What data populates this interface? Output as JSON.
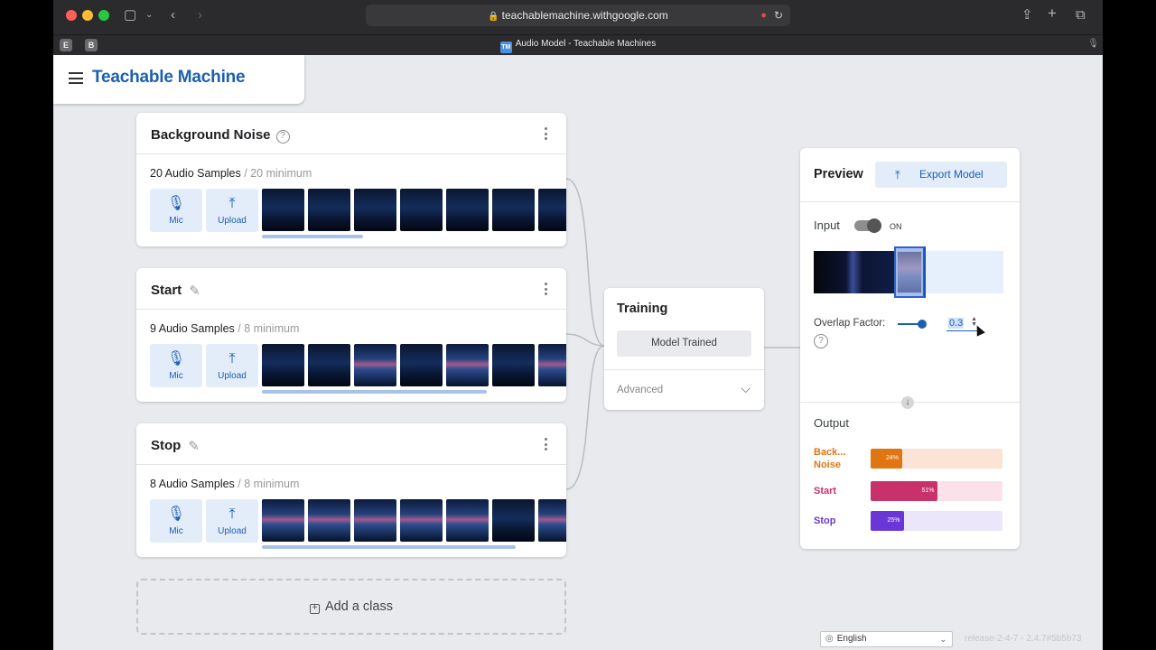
{
  "browser": {
    "url": "teachablemachine.withgoogle.com",
    "tab_title": "Audio Model - Teachable Machines",
    "pinned_tabs": [
      "E",
      "B"
    ],
    "favicon_text": "TM"
  },
  "header": {
    "brand": "Teachable Machine"
  },
  "classes": [
    {
      "title": "Background Noise",
      "count": "20 Audio Samples",
      "minimum": "/ 20 minimum",
      "mic_label": "Mic",
      "upload_label": "Upload"
    },
    {
      "title": "Start",
      "count": "9 Audio Samples",
      "minimum": "/ 8 minimum",
      "mic_label": "Mic",
      "upload_label": "Upload"
    },
    {
      "title": "Stop",
      "count": "8 Audio Samples",
      "minimum": "/ 8 minimum",
      "mic_label": "Mic",
      "upload_label": "Upload"
    }
  ],
  "add_class_label": "Add a class",
  "training": {
    "title": "Training",
    "button": "Model Trained",
    "advanced": "Advanced"
  },
  "preview": {
    "title": "Preview",
    "export_label": "Export Model",
    "input_label": "Input",
    "toggle_state": "ON",
    "overlap_label": "Overlap Factor:",
    "overlap_value": "0.3",
    "output_label": "Output",
    "outputs": [
      {
        "name_line1": "Back...",
        "name_line2": "Noise",
        "percent_label": "24%",
        "percent": 24,
        "color": "#e07512",
        "bg": "#fbe3d6"
      },
      {
        "name_line1": "Start",
        "name_line2": "",
        "percent_label": "51%",
        "percent": 51,
        "color": "#c9316b",
        "bg": "#fbe1ea"
      },
      {
        "name_line1": "Stop",
        "name_line2": "",
        "percent_label": "25%",
        "percent": 25,
        "color": "#6a36d8",
        "bg": "#ece6fa"
      }
    ]
  },
  "footer": {
    "language": "English",
    "release": "release-2-4-7 - 2.4.7#5b5b73"
  }
}
